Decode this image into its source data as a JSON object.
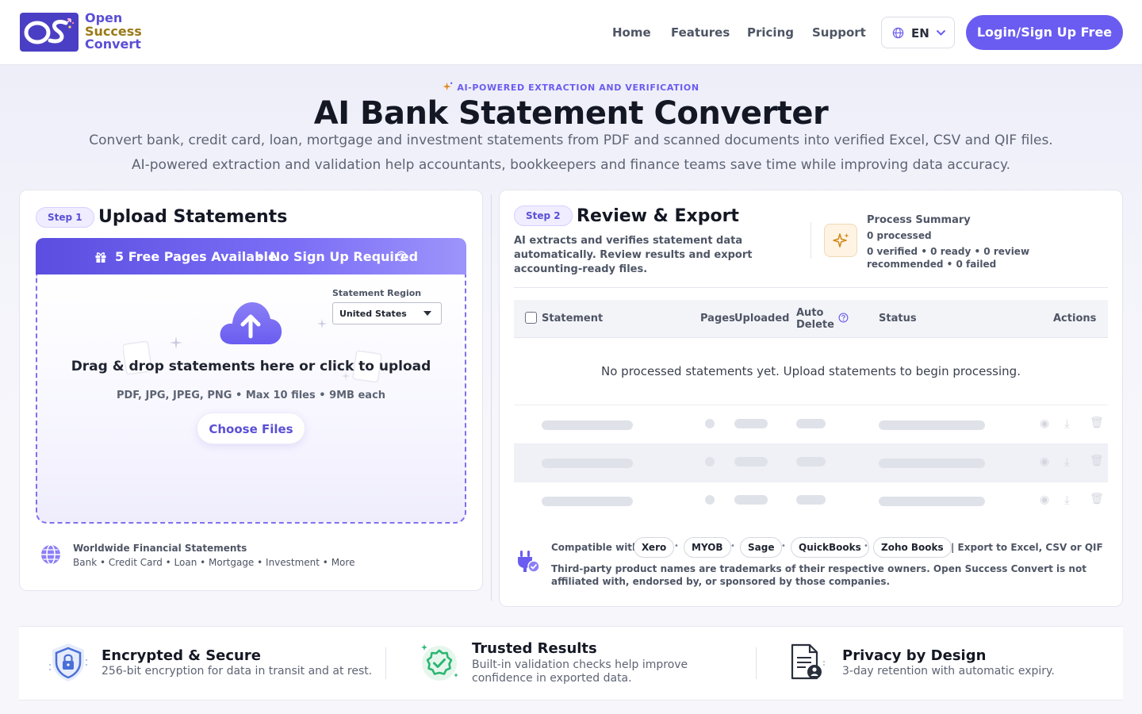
{
  "header": {
    "logo_line1": "Open",
    "logo_line2": "Success",
    "logo_line3": "Convert",
    "nav": [
      "Home",
      "Features",
      "Pricing",
      "Support"
    ],
    "lang": "EN",
    "login": "Login/Sign Up Free"
  },
  "hero": {
    "eyebrow": "AI-POWERED EXTRACTION AND VERIFICATION",
    "title": "AI Bank Statement Converter",
    "sub1": "Convert bank, credit card, loan, mortgage and investment statements from PDF and scanned documents into verified Excel, CSV and QIF files.",
    "sub2": "AI-powered extraction and validation help accountants, bookkeepers and finance teams save time while improving data accuracy."
  },
  "upload": {
    "step": "Step 1",
    "title": "Upload Statements",
    "free_pages": "5 Free Pages Available",
    "separator": "•",
    "no_signup": "No Sign Up Required",
    "region_label": "Statement Region",
    "region_value": "United States",
    "drop_title": "Drag & drop statements here or click to upload",
    "drop_sub": "PDF, JPG, JPEG, PNG • Max 10 files • 9MB each",
    "choose": "Choose Files",
    "worldwide_title": "Worldwide Financial Statements",
    "worldwide_sub": "Bank • Credit Card • Loan • Mortgage • Investment • More"
  },
  "review": {
    "step": "Step 2",
    "title": "Review & Export",
    "desc": "AI extracts and verifies statement data automatically. Review results and export accounting-ready files.",
    "summary_title": "Process Summary",
    "summary_count": "0 processed",
    "summary_detail": "0 verified • 0 ready • 0 review recommended • 0 failed",
    "columns": [
      "Statement",
      "Pages",
      "Uploaded",
      "Auto Delete",
      "Status",
      "Actions"
    ],
    "empty": "No processed statements yet. Upload statements to begin processing.",
    "compatible_label": "Compatible with",
    "chips": [
      "Xero",
      "MYOB",
      "Sage",
      "QuickBooks",
      "Zoho Books"
    ],
    "export": "| Export to Excel, CSV or QIF",
    "disclaimer": "Third-party product names are trademarks of their respective owners. Open Success Convert is not affiliated with, endorsed by, or sponsored by those companies."
  },
  "trust": [
    {
      "title": "Encrypted & Secure",
      "sub": "256-bit encryption for data in transit and at rest."
    },
    {
      "title": "Trusted Results",
      "sub": "Built-in validation checks help improve confidence in exported data."
    },
    {
      "title": "Privacy by Design",
      "sub": "3-day retention with automatic expiry."
    }
  ],
  "colors": {
    "accent": "#6a5cf0",
    "brand_dark": "#4a3fc4",
    "gold": "#9a7a18",
    "trust_green": "#2bb673"
  }
}
